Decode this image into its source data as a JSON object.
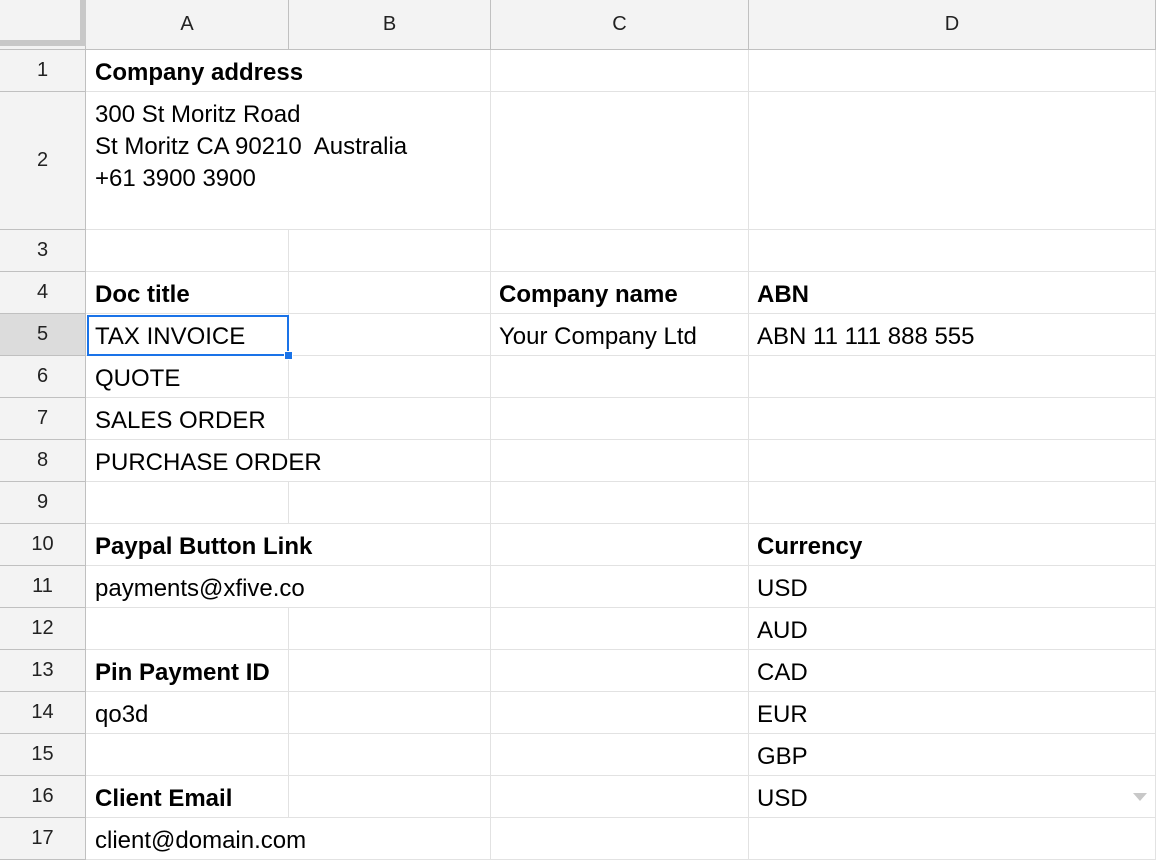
{
  "columns": [
    "A",
    "B",
    "C",
    "D"
  ],
  "rows": [
    "1",
    "2",
    "3",
    "4",
    "5",
    "6",
    "7",
    "8",
    "9",
    "10",
    "11",
    "12",
    "13",
    "14",
    "15",
    "16",
    "17"
  ],
  "cells": {
    "a1": "Company address",
    "a2": "300 St Moritz Road\nSt Moritz CA 90210  Australia\n+61 3900 3900",
    "a4": "Doc title",
    "c4": "Company name",
    "d4": "ABN",
    "a5": "TAX INVOICE",
    "c5": "Your Company Ltd",
    "d5": "ABN 11 111 888 555",
    "a6": "QUOTE",
    "a7": "SALES ORDER",
    "a8": "PURCHASE ORDER",
    "a10": "Paypal Button Link",
    "d10": "Currency",
    "a11": "payments@xfive.co",
    "d11": "USD",
    "d12": "AUD",
    "a13": "Pin Payment ID",
    "d13": "CAD",
    "a14": "qo3d",
    "d14": "EUR",
    "d15": "GBP",
    "a16": "Client Email",
    "d16": "USD",
    "a17": "client@domain.com"
  },
  "selection": {
    "cell": "A5",
    "accent": "#1a73e8"
  },
  "icons": {
    "dropdown": "dropdown-arrow-icon"
  }
}
